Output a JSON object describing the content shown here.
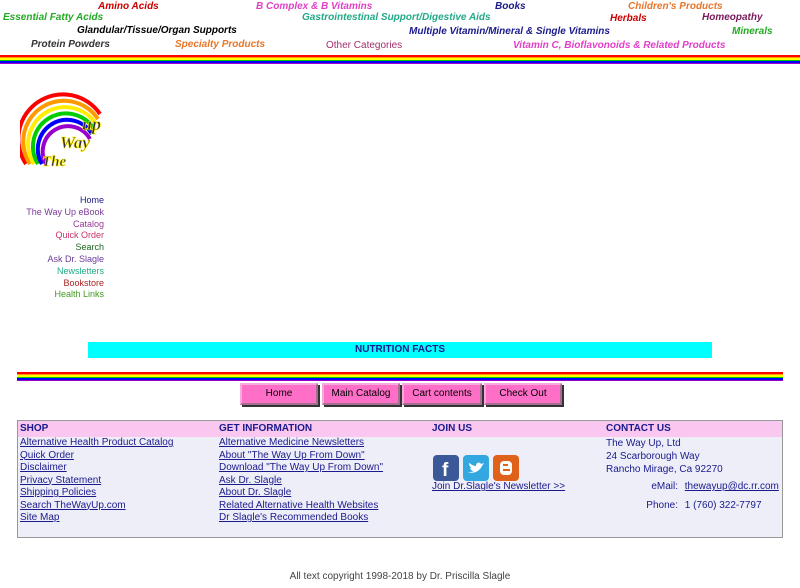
{
  "categories": [
    {
      "label": "Amino Acids",
      "color": "#cc0000"
    },
    {
      "label": "B Complex & B Vitamins",
      "color": "#e040c8"
    },
    {
      "label": "Books",
      "color": "#1a1a8c"
    },
    {
      "label": "Children's Products",
      "color": "#e8762a"
    },
    {
      "label": "Essential Fatty Acids",
      "color": "#22aa22"
    },
    {
      "label": "Gastrointestinal Support/Digestive Aids",
      "color": "#22aa88"
    },
    {
      "label": "Herbals",
      "color": "#cc0000"
    },
    {
      "label": "Homeopathy",
      "color": "#7a1a5a"
    },
    {
      "label": "Glandular/Tissue/Organ Supports",
      "color": "#000000"
    },
    {
      "label": "Multiple Vitamin/Mineral & Single Vitamins",
      "color": "#1a1a8c"
    },
    {
      "label": "Minerals",
      "color": "#22aa22"
    },
    {
      "label": "Protein Powders",
      "color": "#333333"
    },
    {
      "label": "Specialty Products",
      "color": "#e8762a"
    },
    {
      "label": "Other Categories",
      "color": "#a0306a"
    },
    {
      "label": "Vitamin C, Bioflavonoids & Related Products",
      "color": "#e040c8"
    }
  ],
  "logo": {
    "line1": "up",
    "line2": "Way",
    "line3": "The"
  },
  "sidebar": [
    {
      "label": "Home",
      "color": "#1a1a8c"
    },
    {
      "label": "The Way Up eBook",
      "color": "#7a3a9a"
    },
    {
      "label": "Catalog",
      "color": "#9a3a9a"
    },
    {
      "label": "Quick Order",
      "color": "#cc3366"
    },
    {
      "label": "Search",
      "color": "#226622"
    },
    {
      "label": "Ask Dr. Slagle",
      "color": "#6a3a9a"
    },
    {
      "label": "Newsletters",
      "color": "#22aa88"
    },
    {
      "label": "Bookstore",
      "color": "#aa2222"
    },
    {
      "label": "Health Links",
      "color": "#449922"
    }
  ],
  "banner": "NUTRITION FACTS",
  "buttons": [
    "Home",
    "Main Catalog",
    "Cart contents",
    "Check Out"
  ],
  "footer": {
    "shop": {
      "title": "SHOP",
      "links": [
        "Alternative Health Product Catalog",
        "Quick Order",
        "Disclaimer",
        "Privacy Statement",
        "Shipping Policies",
        "Search TheWayUp.com",
        "Site Map"
      ]
    },
    "info": {
      "title": "GET INFORMATION",
      "links": [
        "Alternative Medicine Newsletters",
        "About \"The Way Up From Down\"",
        "Download \"The Way Up From Down\"",
        "Ask Dr. Slagle",
        "About Dr. Slagle",
        "Related Alternative Health Websites",
        "Dr Slagle's Recommended Books"
      ]
    },
    "join": {
      "title": "JOIN US",
      "newsletter": "Join Dr.Slagle's Newsletter >>",
      "icons": [
        "facebook-icon",
        "twitter-icon",
        "blogger-icon"
      ]
    },
    "contact": {
      "title": "CONTACT US",
      "name": "The Way Up, Ltd",
      "street": "24 Scarborough Way",
      "city": "Rancho Mirage, Ca 92270",
      "email_label": "eMail:",
      "email": "thewayup@dc.rr.com",
      "phone_label": "Phone:",
      "phone": "1 (760) 322-7797"
    }
  },
  "copyright": "All text copyright 1998-2018 by Dr. Priscilla Slagle",
  "colors": {
    "rainbow": [
      "#ff0000",
      "#ff9900",
      "#ffff00",
      "#00cc00",
      "#0000ff",
      "#9900cc"
    ]
  }
}
